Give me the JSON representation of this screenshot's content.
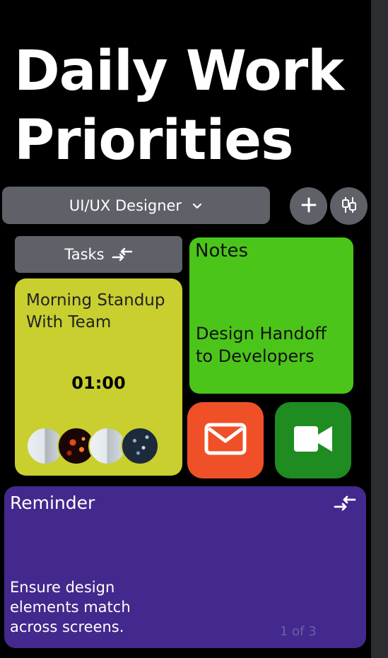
{
  "page": {
    "title": "Daily Work Priorities"
  },
  "toolbar": {
    "role_label": "UI/UX Designer",
    "chevron_icon": "chevron-down-icon",
    "add_icon": "plus-icon",
    "filter_icon": "filter-icon"
  },
  "tasks": {
    "button_label": "Tasks",
    "swap_icon": "swap-arrows-icon",
    "card": {
      "title": "Morning Standup With Team",
      "time": "01:00",
      "color": "#c8cf2f"
    }
  },
  "notes": {
    "label": "Notes",
    "text": "Design Handoff to Developers",
    "color": "#4cc51a"
  },
  "shortcuts": {
    "mail": {
      "icon": "mail-icon",
      "color": "#ef5027"
    },
    "video": {
      "icon": "video-camera-icon",
      "color": "#1e8c21"
    }
  },
  "reminder": {
    "label": "Reminder",
    "text": "Ensure design elements match across screens.",
    "page_indicator": "1 of 3",
    "color": "#43288d"
  }
}
